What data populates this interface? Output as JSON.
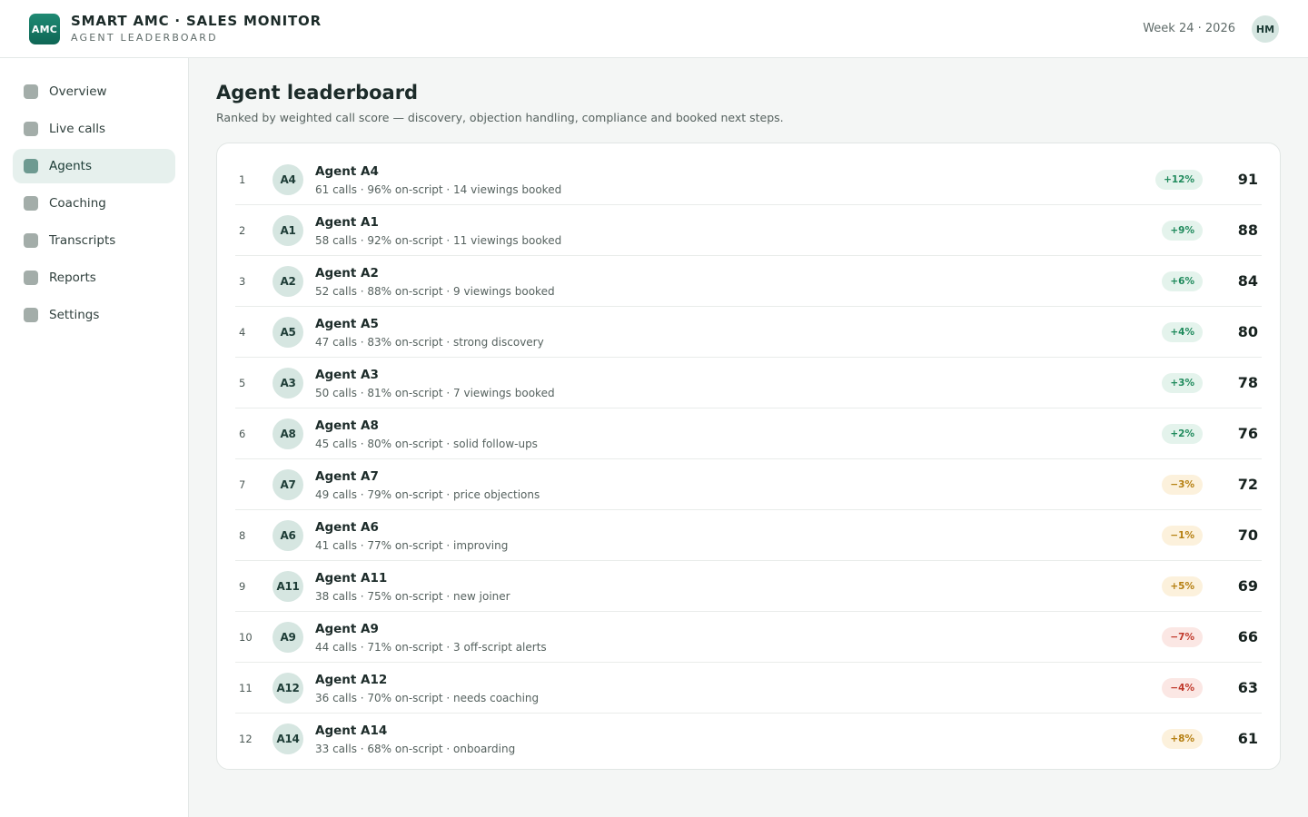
{
  "app": {
    "logo_text": "AMC",
    "title": "SMART AMC · SALES MONITOR",
    "subtitle": "AGENT LEADERBOARD",
    "week": "Week 24 · 2026",
    "user_initials": "HM"
  },
  "sidebar": {
    "items": [
      {
        "label": "Overview",
        "active": false
      },
      {
        "label": "Live calls",
        "active": false
      },
      {
        "label": "Agents",
        "active": true
      },
      {
        "label": "Coaching",
        "active": false
      },
      {
        "label": "Transcripts",
        "active": false
      },
      {
        "label": "Reports",
        "active": false
      },
      {
        "label": "Settings",
        "active": false
      }
    ]
  },
  "main": {
    "title": "Agent leaderboard",
    "description": "Ranked by weighted call score — discovery, objection handling, compliance and booked next steps."
  },
  "colors": {
    "accent": "#0f6655",
    "positive": "#1f8a5c",
    "warning": "#b57f10",
    "negative": "#c0392b"
  },
  "leaderboard": [
    {
      "rank": "1",
      "initials": "A4",
      "name": "Agent A4",
      "meta": "61 calls · 96% on-script · 14 viewings booked",
      "delta": "+12%",
      "tone": "green",
      "score": "91"
    },
    {
      "rank": "2",
      "initials": "A1",
      "name": "Agent A1",
      "meta": "58 calls · 92% on-script · 11 viewings booked",
      "delta": "+9%",
      "tone": "green",
      "score": "88"
    },
    {
      "rank": "3",
      "initials": "A2",
      "name": "Agent A2",
      "meta": "52 calls · 88% on-script · 9 viewings booked",
      "delta": "+6%",
      "tone": "green",
      "score": "84"
    },
    {
      "rank": "4",
      "initials": "A5",
      "name": "Agent A5",
      "meta": "47 calls · 83% on-script · strong discovery",
      "delta": "+4%",
      "tone": "green",
      "score": "80"
    },
    {
      "rank": "5",
      "initials": "A3",
      "name": "Agent A3",
      "meta": "50 calls · 81% on-script · 7 viewings booked",
      "delta": "+3%",
      "tone": "green",
      "score": "78"
    },
    {
      "rank": "6",
      "initials": "A8",
      "name": "Agent A8",
      "meta": "45 calls · 80% on-script · solid follow-ups",
      "delta": "+2%",
      "tone": "green",
      "score": "76"
    },
    {
      "rank": "7",
      "initials": "A7",
      "name": "Agent A7",
      "meta": "49 calls · 79% on-script · price objections",
      "delta": "−3%",
      "tone": "amber",
      "score": "72"
    },
    {
      "rank": "8",
      "initials": "A6",
      "name": "Agent A6",
      "meta": "41 calls · 77% on-script · improving",
      "delta": "−1%",
      "tone": "amber",
      "score": "70"
    },
    {
      "rank": "9",
      "initials": "A11",
      "name": "Agent A11",
      "meta": "38 calls · 75% on-script · new joiner",
      "delta": "+5%",
      "tone": "amber",
      "score": "69"
    },
    {
      "rank": "10",
      "initials": "A9",
      "name": "Agent A9",
      "meta": "44 calls · 71% on-script · 3 off-script alerts",
      "delta": "−7%",
      "tone": "red",
      "score": "66"
    },
    {
      "rank": "11",
      "initials": "A12",
      "name": "Agent A12",
      "meta": "36 calls · 70% on-script · needs coaching",
      "delta": "−4%",
      "tone": "red",
      "score": "63"
    },
    {
      "rank": "12",
      "initials": "A14",
      "name": "Agent A14",
      "meta": "33 calls · 68% on-script · onboarding",
      "delta": "+8%",
      "tone": "amber",
      "score": "61"
    }
  ]
}
